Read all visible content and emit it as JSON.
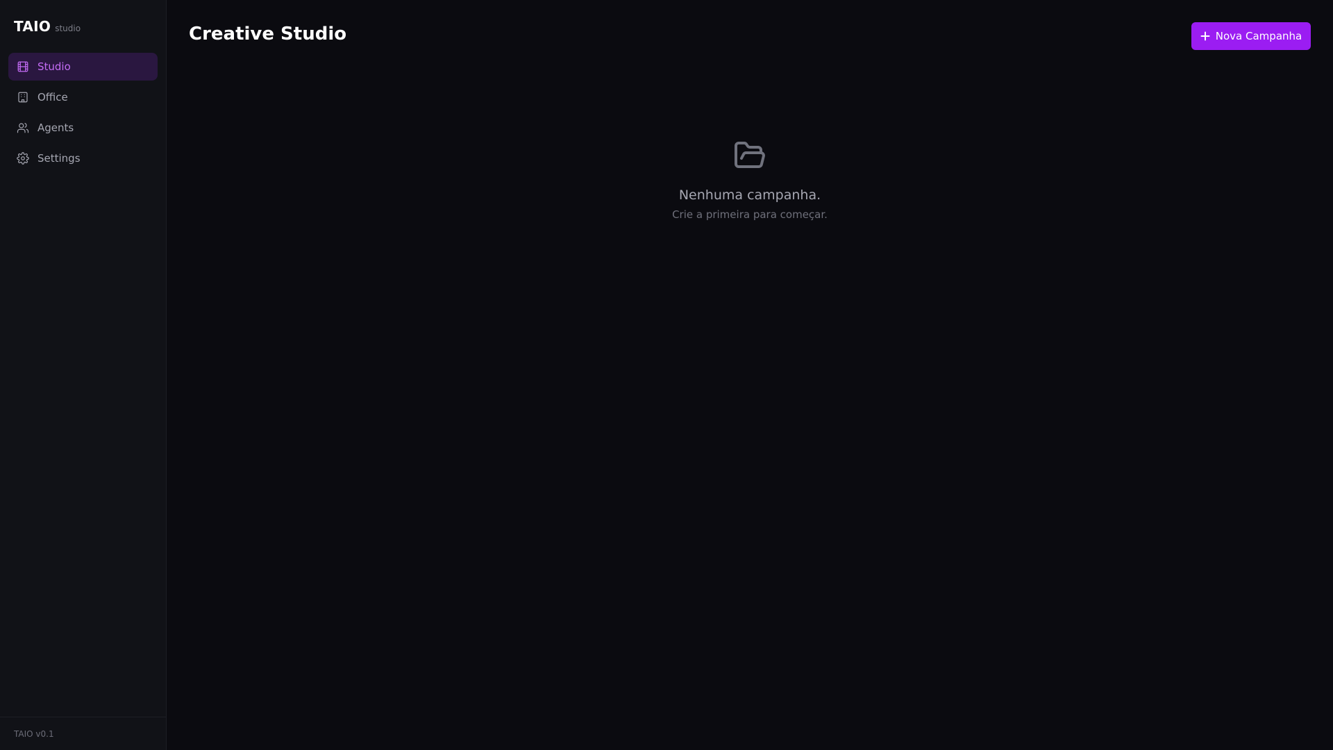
{
  "app": {
    "brand_name": "TAIO",
    "brand_sub": "studio",
    "version": "TAIO v0.1"
  },
  "sidebar": {
    "items": [
      {
        "label": "Studio",
        "icon": "film-icon",
        "active": true
      },
      {
        "label": "Office",
        "icon": "building-icon",
        "active": false
      },
      {
        "label": "Agents",
        "icon": "users-icon",
        "active": false
      },
      {
        "label": "Settings",
        "icon": "gear-icon",
        "active": false
      }
    ]
  },
  "header": {
    "title": "Creative Studio",
    "new_button_label": "Nova Campanha",
    "new_button_icon": "plus-icon"
  },
  "empty_state": {
    "icon": "folder-open-icon",
    "title": "Nenhuma campanha.",
    "subtitle": "Crie a primeira para começar."
  },
  "colors": {
    "accent": "#9b1df2",
    "active_item_text": "#c46cf5",
    "active_item_bg": "#2a1740",
    "background": "#0b0b10",
    "sidebar_background": "#111217"
  }
}
